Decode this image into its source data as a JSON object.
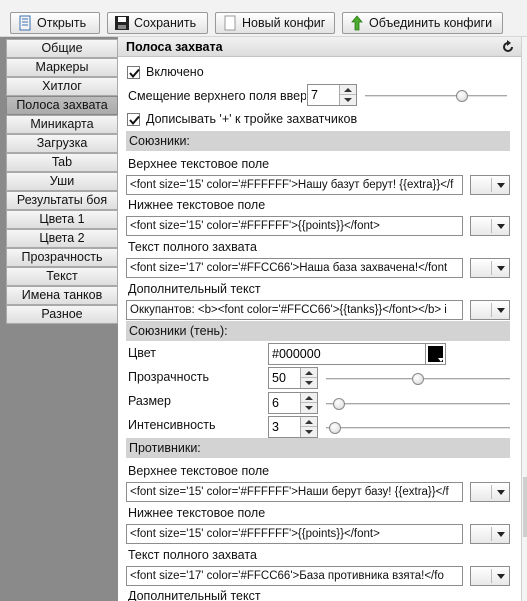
{
  "toolbar": {
    "open_label": "Открыть",
    "save_label": "Сохранить",
    "new_config_label": "Новый конфиг",
    "merge_configs_label": "Объединить конфиги"
  },
  "sidebar": {
    "items": [
      {
        "label": "Общие"
      },
      {
        "label": "Маркеры"
      },
      {
        "label": "Хитлог"
      },
      {
        "label": "Полоса захвата",
        "active": true
      },
      {
        "label": "Миникарта"
      },
      {
        "label": "Загрузка"
      },
      {
        "label": "Tab"
      },
      {
        "label": "Уши"
      },
      {
        "label": "Результаты боя"
      },
      {
        "label": "Цвета 1"
      },
      {
        "label": "Цвета 2"
      },
      {
        "label": "Прозрачность"
      },
      {
        "label": "Текст"
      },
      {
        "label": "Имена танков"
      },
      {
        "label": "Разное"
      }
    ]
  },
  "panel": {
    "title": "Полоса захвата",
    "enabled_label": "Включено",
    "enabled_checked": true,
    "offset_label": "Смещение верхнего поля вверх",
    "offset_value": "7",
    "offset_slider_fraction": 0.7,
    "append_plus_label": "Дописывать '+' к тройке захватчиков",
    "append_plus_checked": true,
    "allies": {
      "header": "Союзники:",
      "top_label": "Верхнее текстовое поле",
      "top_value": "<font size='15' color='#FFFFFF'>Нашу базут берут! {{extra}}</f",
      "bottom_label": "Нижнее текстовое поле",
      "bottom_value": "<font size='15' color='#FFFFFF'>{{points}}</font>",
      "full_label": "Текст полного захвата",
      "full_value": "<font size='17' color='#FFCC66'>Наша база захвачена!</font",
      "extra_label": "Дополнительный текст",
      "extra_value": "Оккупантов: <b><font color='#FFCC66'>{{tanks}}</font></b> i"
    },
    "allies_shadow": {
      "header": "Союзники (тень):",
      "color_label": "Цвет",
      "color_value": "#000000",
      "color_swatch": "#000000",
      "alpha_label": "Прозрачность",
      "alpha_value": "50",
      "alpha_fraction": 0.5,
      "size_label": "Размер",
      "size_value": "6",
      "size_fraction": 0.04,
      "strength_label": "Интенсивность",
      "strength_value": "3",
      "strength_fraction": 0.02
    },
    "enemies": {
      "header": "Противники:",
      "top_label": "Верхнее текстовое поле",
      "top_value": "<font size='15' color='#FFFFFF'>Наши берут базу! {{extra}}</f",
      "bottom_label": "Нижнее текстовое поле",
      "bottom_value": "<font size='15' color='#FFFFFF'>{{points}}</font>",
      "full_label": "Текст полного захвата",
      "full_value": "<font size='17' color='#FFCC66'>База противника взята!</fo",
      "extra_label": "Дополнительный текст"
    }
  }
}
